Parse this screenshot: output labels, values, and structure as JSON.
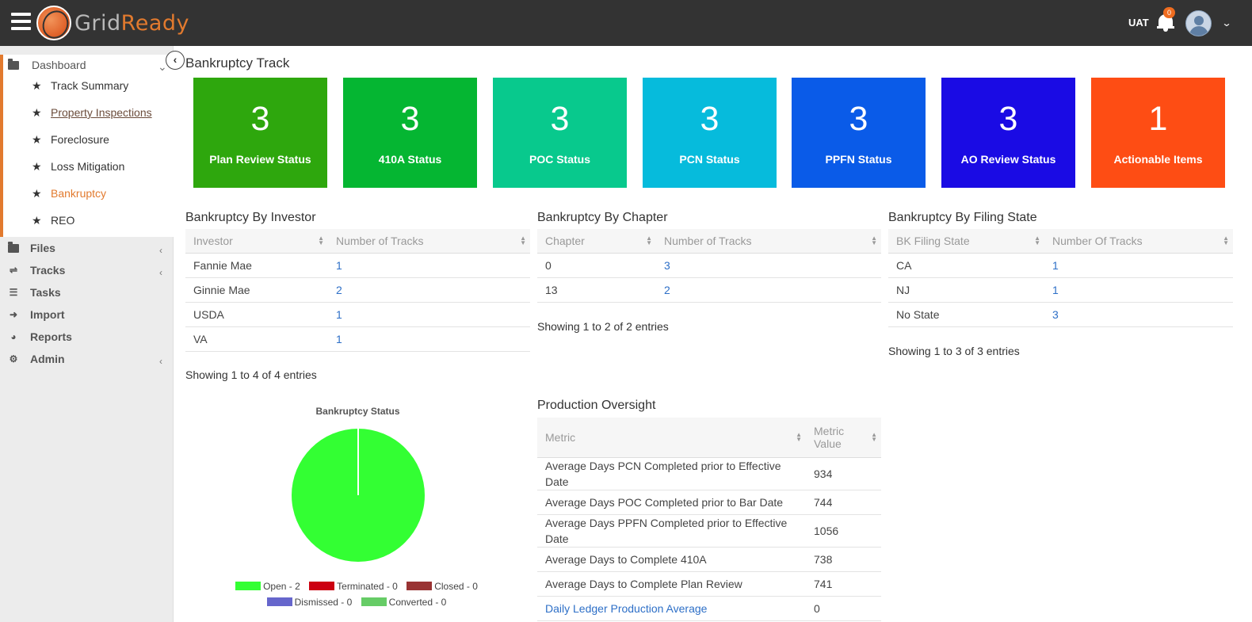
{
  "header": {
    "logo_grid": "Grid",
    "logo_ready": "Ready",
    "env": "UAT",
    "notifications_count": "0"
  },
  "sidebar": {
    "dashboard_label": "Dashboard",
    "sub_items": [
      {
        "label": "Track Summary"
      },
      {
        "label": "Property Inspections"
      },
      {
        "label": "Foreclosure"
      },
      {
        "label": "Loss Mitigation"
      },
      {
        "label": "Bankruptcy"
      },
      {
        "label": "REO"
      }
    ],
    "main_items": [
      {
        "label": "Files",
        "icon": "folder-icon"
      },
      {
        "label": "Tracks",
        "icon": "shuffle-icon"
      },
      {
        "label": "Tasks",
        "icon": "list-icon"
      },
      {
        "label": "Import",
        "icon": "arrow-right-icon"
      },
      {
        "label": "Reports",
        "icon": "pie-chart-icon"
      },
      {
        "label": "Admin",
        "icon": "gear-icon"
      }
    ]
  },
  "page_title": "Bankruptcy Track",
  "tiles": [
    {
      "value": "3",
      "label": "Plan Review Status",
      "color": "#2ea70d"
    },
    {
      "value": "3",
      "label": "410A Status",
      "color": "#05b632"
    },
    {
      "value": "3",
      "label": "POC Status",
      "color": "#08c98d"
    },
    {
      "value": "3",
      "label": "PCN Status",
      "color": "#06bbdc"
    },
    {
      "value": "3",
      "label": "PPFN Status",
      "color": "#0a5be8"
    },
    {
      "value": "3",
      "label": "AO Review Status",
      "color": "#1a0be4"
    },
    {
      "value": "1",
      "label": "Actionable Items",
      "color": "#fe4d14"
    }
  ],
  "by_investor": {
    "title": "Bankruptcy By Investor",
    "headers": [
      "Investor",
      "Number of Tracks"
    ],
    "rows": [
      [
        "Fannie Mae",
        "1"
      ],
      [
        "Ginnie Mae",
        "2"
      ],
      [
        "USDA",
        "1"
      ],
      [
        "VA",
        "1"
      ]
    ],
    "info": "Showing 1 to 4 of 4 entries"
  },
  "by_chapter": {
    "title": "Bankruptcy By Chapter",
    "headers": [
      "Chapter",
      "Number of Tracks"
    ],
    "rows": [
      [
        "0",
        "3"
      ],
      [
        "13",
        "2"
      ]
    ],
    "info": "Showing 1 to 2 of 2 entries"
  },
  "by_state": {
    "title": "Bankruptcy By Filing State",
    "headers": [
      "BK Filing State",
      "Number Of Tracks"
    ],
    "rows": [
      [
        "CA",
        "1"
      ],
      [
        "NJ",
        "1"
      ],
      [
        "No State",
        "3"
      ]
    ],
    "info": "Showing 1 to 3 of 3 entries"
  },
  "production": {
    "title": "Production Oversight",
    "headers": [
      "Metric",
      "Metric Value"
    ],
    "rows": [
      [
        "Average Days PCN Completed prior to Effective Date",
        "934"
      ],
      [
        "Average Days POC Completed prior to Bar Date",
        "744"
      ],
      [
        "Average Days PPFN Completed prior to Effective Date",
        "1056"
      ],
      [
        "Average Days to Complete 410A",
        "738"
      ],
      [
        "Average Days to Complete Plan Review",
        "741"
      ],
      [
        "Daily Ledger Production Average",
        "0"
      ]
    ]
  },
  "chart_data": {
    "type": "pie",
    "title": "Bankruptcy Status",
    "slices": [
      {
        "label": "Open - 2",
        "value": 2,
        "color": "#33ff33"
      },
      {
        "label": "Terminated - 0",
        "value": 0,
        "color": "#cc0011"
      },
      {
        "label": "Closed - 0",
        "value": 0,
        "color": "#993333"
      },
      {
        "label": "Dismissed - 0",
        "value": 0,
        "color": "#6666cc"
      },
      {
        "label": "Converted - 0",
        "value": 0,
        "color": "#66cc66"
      }
    ]
  }
}
